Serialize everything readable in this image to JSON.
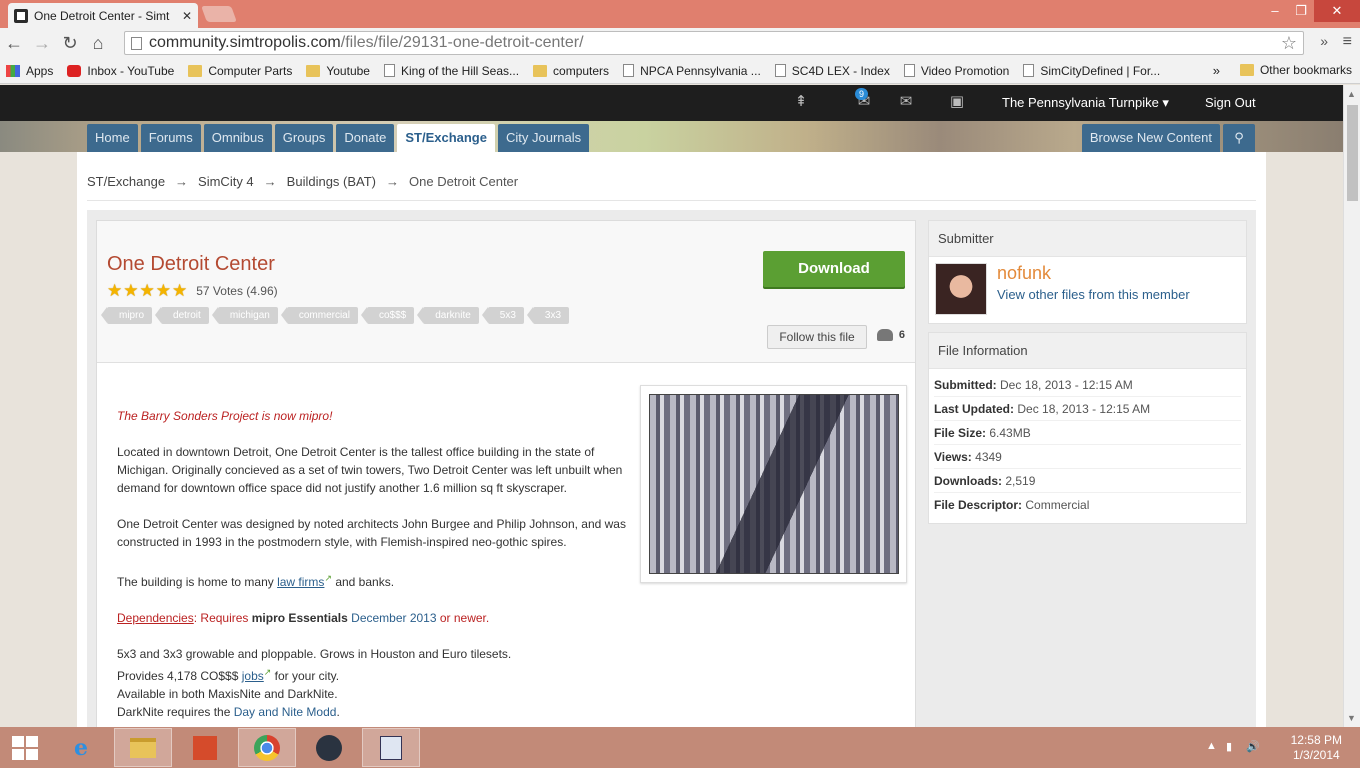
{
  "browser": {
    "tab_title": "One Detroit Center - Simt",
    "url_host": "community.simtropolis.com",
    "url_path": "/files/file/29131-one-detroit-center/",
    "bookmarks": [
      {
        "label": "Apps",
        "icon": "apps-icon"
      },
      {
        "label": "Inbox - YouTube",
        "icon": "youtube-icon"
      },
      {
        "label": "Computer Parts",
        "icon": "folder-icon"
      },
      {
        "label": "Youtube",
        "icon": "folder-icon"
      },
      {
        "label": "King of the Hill Seas...",
        "icon": "page-icon"
      },
      {
        "label": "computers",
        "icon": "folder-icon"
      },
      {
        "label": "NPCA Pennsylvania ...",
        "icon": "page-icon"
      },
      {
        "label": "SC4D LEX - Index",
        "icon": "page-icon"
      },
      {
        "label": "Video Promotion",
        "icon": "page-icon"
      },
      {
        "label": "SimCityDefined | For...",
        "icon": "page-icon"
      }
    ],
    "bookmarks_more": "»",
    "other_bookmarks": "Other bookmarks"
  },
  "userbar": {
    "notification_count": "9",
    "username": "The Pennsylvania Turnpike",
    "sign_out": "Sign Out"
  },
  "nav": {
    "tabs": [
      "Home",
      "Forums",
      "Omnibus",
      "Groups",
      "Donate",
      "ST/Exchange",
      "City Journals"
    ],
    "active": "ST/Exchange",
    "browse_new": "Browse New Content"
  },
  "breadcrumb": [
    "ST/Exchange",
    "SimCity 4",
    "Buildings (BAT)",
    "One Detroit Center"
  ],
  "breadcrumb_sep": "→",
  "file": {
    "title": "One Detroit Center",
    "rating": 4.96,
    "stars": 5,
    "votes_text": "57 Votes (4.96)",
    "tags": [
      "mipro",
      "detroit",
      "michigan",
      "commercial",
      "co$$$",
      "darknite",
      "5x3",
      "3x3"
    ],
    "download_label": "Download",
    "follow_label": "Follow this file",
    "followers": "6",
    "description": {
      "intro": "The Barry Sonders Project is now mipro!",
      "p1": "Located in downtown Detroit, One Detroit Center is the tallest office building in the state of Michigan. Originally concieved as a set of twin towers, Two Detroit Center was left unbuilt when demand for downtown office space did not justify another 1.6 million sq ft skyscraper.",
      "p2": "One Detroit Center was designed by noted architects John Burgee and Philip Johnson, and was constructed in 1993 in the postmodern style, with Flemish-inspired neo-gothic spires.",
      "p3_before": "The building is home to many ",
      "p3_link": "law firms",
      "p3_after": " and banks.",
      "dep_label": "Dependencies",
      "dep_text": ": Requires ",
      "dep_bold": "mipro Essentials",
      "dep_date": " December 2013",
      "dep_end": " or newer.",
      "l1": "5x3 and 3x3 growable and ploppable. Grows in Houston and Euro tilesets.",
      "l2_before": "Provides 4,178 CO$$$ ",
      "l2_link": "jobs",
      "l2_after": " for your city.",
      "l3": "Available in both MaxisNite and DarkNite.",
      "l4_before": "DarkNite requires the ",
      "l4_link": "Day and Nite Modd",
      "l4_after": "."
    }
  },
  "submitter": {
    "heading": "Submitter",
    "name": "nofunk",
    "link": "View other files from this member"
  },
  "file_info": {
    "heading": "File Information",
    "rows": [
      {
        "label": "Submitted:",
        "value": "Dec 18, 2013 - 12:15 AM"
      },
      {
        "label": "Last Updated:",
        "value": "Dec 18, 2013 - 12:15 AM"
      },
      {
        "label": "File Size:",
        "value": "6.43MB"
      },
      {
        "label": "Views:",
        "value": "4349"
      },
      {
        "label": "Downloads:",
        "value": "2,519"
      },
      {
        "label": "File Descriptor:",
        "value": "Commercial"
      }
    ]
  },
  "taskbar": {
    "time": "12:58 PM",
    "date": "1/3/2014"
  },
  "colors": {
    "title_red": "#b44a32",
    "download_green": "#5b9f33",
    "nav_blue": "#3d6a8e",
    "submitter_orange": "#e38a3a"
  }
}
